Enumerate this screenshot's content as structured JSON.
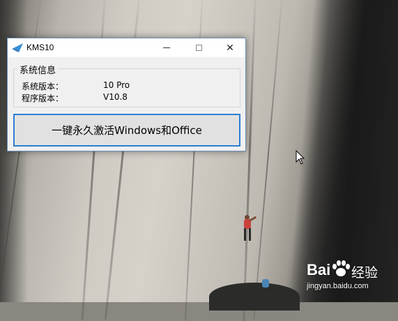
{
  "window": {
    "title": "KMS10",
    "minimize_icon": "minimize-icon",
    "maximize_icon": "maximize-icon",
    "close_glyph": "✕"
  },
  "system_info": {
    "group_title": "系统信息",
    "os_version_label": "系统版本：",
    "os_version_value": "10 Pro",
    "app_version_label": "程序版本：",
    "app_version_value": "V10.8"
  },
  "activate_button_label": "一键永久激活Windows和Office",
  "watermark": {
    "brand": "Bai",
    "brand_cn": "经验",
    "url": "jingyan.baidu.com"
  },
  "colors": {
    "accent": "#2a7fd4",
    "app_icon": "#3a8fd6"
  }
}
